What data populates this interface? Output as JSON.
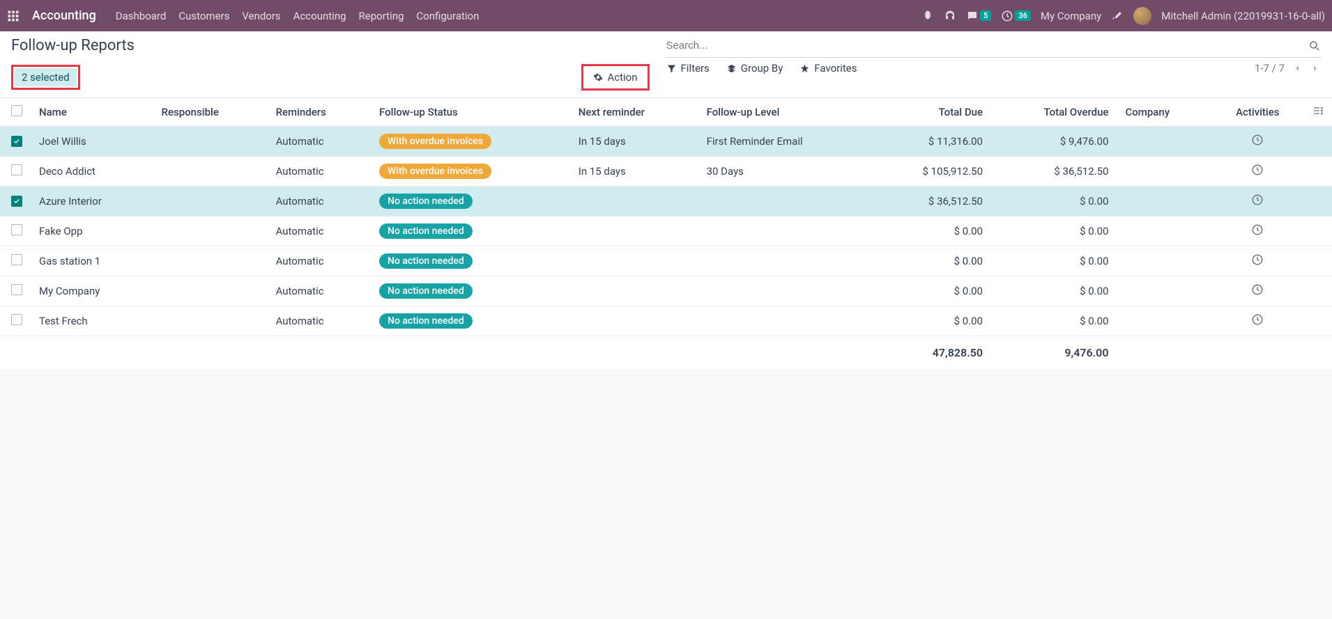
{
  "navbar": {
    "app_title": "Accounting",
    "menu": [
      "Dashboard",
      "Customers",
      "Vendors",
      "Accounting",
      "Reporting",
      "Configuration"
    ],
    "messages_count": "5",
    "activities_count": "36",
    "company": "My Company",
    "user": "Mitchell Admin (22019931-16-0-all)"
  },
  "breadcrumb": {
    "title": "Follow-up Reports",
    "selected": "2 selected"
  },
  "action_button": "Action",
  "search": {
    "placeholder": "Search...",
    "filters": "Filters",
    "group_by": "Group By",
    "favorites": "Favorites",
    "pager": "1-7 / 7"
  },
  "columns": {
    "name": "Name",
    "responsible": "Responsible",
    "reminders": "Reminders",
    "status": "Follow-up Status",
    "next": "Next reminder",
    "level": "Follow-up Level",
    "due": "Total Due",
    "overdue": "Total Overdue",
    "company": "Company",
    "activities": "Activities"
  },
  "status_labels": {
    "overdue": "With overdue invoices",
    "noaction": "No action needed"
  },
  "rows": [
    {
      "checked": true,
      "name": "Joel Willis",
      "reminders": "Automatic",
      "status": "overdue",
      "next": "In 15 days",
      "level": "First Reminder Email",
      "due": "$ 11,316.00",
      "overdue": "$ 9,476.00"
    },
    {
      "checked": false,
      "name": "Deco Addict",
      "reminders": "Automatic",
      "status": "overdue",
      "next": "In 15 days",
      "level": "30 Days",
      "due": "$ 105,912.50",
      "overdue": "$ 36,512.50"
    },
    {
      "checked": true,
      "name": "Azure Interior",
      "reminders": "Automatic",
      "status": "noaction",
      "next": "",
      "level": "",
      "due": "$ 36,512.50",
      "overdue": "$ 0.00"
    },
    {
      "checked": false,
      "name": "Fake Opp",
      "reminders": "Automatic",
      "status": "noaction",
      "next": "",
      "level": "",
      "due": "$ 0.00",
      "overdue": "$ 0.00"
    },
    {
      "checked": false,
      "name": "Gas station 1",
      "reminders": "Automatic",
      "status": "noaction",
      "next": "",
      "level": "",
      "due": "$ 0.00",
      "overdue": "$ 0.00"
    },
    {
      "checked": false,
      "name": "My Company",
      "reminders": "Automatic",
      "status": "noaction",
      "next": "",
      "level": "",
      "due": "$ 0.00",
      "overdue": "$ 0.00"
    },
    {
      "checked": false,
      "name": "Test Frech",
      "reminders": "Automatic",
      "status": "noaction",
      "next": "",
      "level": "",
      "due": "$ 0.00",
      "overdue": "$ 0.00"
    }
  ],
  "totals": {
    "due": "47,828.50",
    "overdue": "9,476.00"
  }
}
